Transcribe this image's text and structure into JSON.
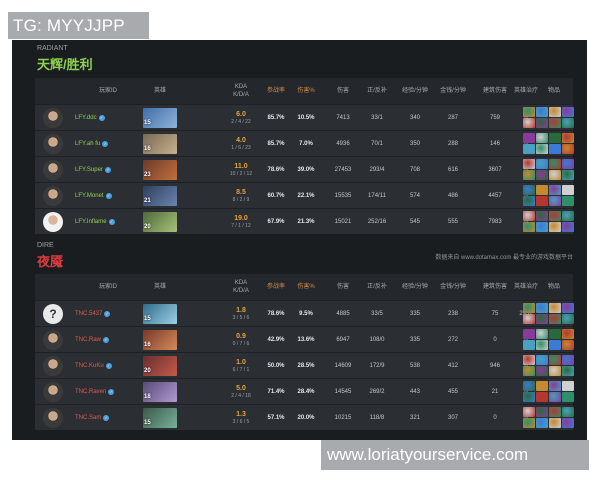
{
  "watermarks": {
    "top": "TG: MYYJJPP",
    "bottom": "www.loriatyourservice.com"
  },
  "radiant": {
    "subtitle": "RADIANT",
    "title": "天辉/胜利",
    "title_color": "#8fd14f"
  },
  "dire": {
    "subtitle": "DIRE",
    "title": "夜魇",
    "title_color": "#e23a3a",
    "source": "数据来自 www.dotamax.com 最专业的游戏数据平台"
  },
  "columns": {
    "player": "玩家ID",
    "hero": "英雄",
    "kda_line1": "KDA",
    "kda_line2": "K/D/A",
    "participation": "参战率",
    "damage_pct": "伤害%",
    "damage": "伤害",
    "lh_dn": "正/反补",
    "xpm": "经验/分钟",
    "gpm": "金钱/分钟",
    "building": "建筑伤害",
    "heal": "英雄治疗",
    "items": "物品"
  },
  "colors": {
    "name_radiant": "#8fd14f",
    "name_dire": "#e05a4a",
    "kda_ratio": "#e6a23c",
    "highlight_header": "#d48a4a"
  },
  "radiant_rows": [
    {
      "name": "LFY.ddc",
      "level": "15",
      "ratio": "6.0",
      "kda": "2 / 4 / 22",
      "part": "85.7%",
      "dmgpct": "10.5%",
      "dmg": "7413",
      "lhdn": "33/1",
      "xpm": "340",
      "gpm": "287",
      "bld": "759",
      "heal": "0",
      "avatar": "dark",
      "hero_colors": [
        "#3f6fa8",
        "#8fb3d9"
      ]
    },
    {
      "name": "LFY.ah fu",
      "level": "16",
      "ratio": "4.0",
      "kda": "1 / 6 / 23",
      "part": "85.7%",
      "dmgpct": "7.0%",
      "dmg": "4936",
      "lhdn": "70/1",
      "xpm": "350",
      "gpm": "288",
      "bld": "146",
      "heal": "0",
      "avatar": "dark",
      "hero_colors": [
        "#7a6a55",
        "#c7b08c"
      ]
    },
    {
      "name": "LFY.Super",
      "level": "23",
      "ratio": "11.0",
      "kda": "10 / 2 / 12",
      "part": "78.6%",
      "dmgpct": "39.0%",
      "dmg": "27453",
      "lhdn": "293/4",
      "xpm": "708",
      "gpm": "616",
      "bld": "3607",
      "heal": "0",
      "avatar": "dark",
      "hero_colors": [
        "#6b3a2a",
        "#c2703e"
      ]
    },
    {
      "name": "LFY.Monet",
      "level": "21",
      "ratio": "8.5",
      "kda": "8 / 2 / 9",
      "part": "60.7%",
      "dmgpct": "22.1%",
      "dmg": "15535",
      "lhdn": "174/11",
      "xpm": "574",
      "gpm": "486",
      "bld": "4457",
      "heal": "0",
      "avatar": "dark",
      "hero_colors": [
        "#2e3f5c",
        "#6a84b0"
      ]
    },
    {
      "name": "LFY.Inflame",
      "level": "20",
      "ratio": "19.0",
      "kda": "7 / 1 / 12",
      "part": "67.9%",
      "dmgpct": "21.3%",
      "dmg": "15021",
      "lhdn": "252/16",
      "xpm": "545",
      "gpm": "555",
      "bld": "7983",
      "heal": "0",
      "avatar": "light",
      "hero_colors": [
        "#4d6b3a",
        "#a8c07a"
      ]
    }
  ],
  "dire_rows": [
    {
      "name": "TNC.5437",
      "level": "15",
      "ratio": "1.8",
      "kda": "3 / 5 / 6",
      "part": "78.6%",
      "dmgpct": "9.5%",
      "dmg": "4885",
      "lhdn": "33/5",
      "xpm": "335",
      "gpm": "238",
      "bld": "75",
      "heal": "2932",
      "avatar": "question",
      "avatar_text": "?",
      "hero_colors": [
        "#2f6b8a",
        "#9fd0e6"
      ]
    },
    {
      "name": "TNC.Raw",
      "level": "16",
      "ratio": "0.9",
      "kda": "0 / 7 / 6",
      "part": "42.9%",
      "dmgpct": "13.6%",
      "dmg": "6947",
      "lhdn": "108/0",
      "xpm": "335",
      "gpm": "272",
      "bld": "0",
      "heal": "0",
      "avatar": "dark",
      "hero_colors": [
        "#7a3a2a",
        "#d48a5a"
      ]
    },
    {
      "name": "TNC.KuKu",
      "level": "20",
      "ratio": "1.0",
      "kda": "6 / 7 / 1",
      "part": "50.0%",
      "dmgpct": "28.5%",
      "dmg": "14609",
      "lhdn": "172/9",
      "xpm": "538",
      "gpm": "412",
      "bld": "946",
      "heal": "0",
      "avatar": "dark",
      "hero_colors": [
        "#6a2f2f",
        "#c45a4a"
      ]
    },
    {
      "name": "TNC.Raven",
      "level": "18",
      "ratio": "5.0",
      "kda": "2 / 4 / 18",
      "part": "71.4%",
      "dmgpct": "28.4%",
      "dmg": "14545",
      "lhdn": "269/2",
      "xpm": "443",
      "gpm": "455",
      "bld": "21",
      "heal": "0",
      "avatar": "dark",
      "hero_colors": [
        "#5a4a7a",
        "#b09ad0"
      ]
    },
    {
      "name": "TNC.Sam",
      "level": "15",
      "ratio": "1.3",
      "kda": "3 / 6 / 5",
      "part": "57.1%",
      "dmgpct": "20.0%",
      "dmg": "10215",
      "lhdn": "118/8",
      "xpm": "321",
      "gpm": "307",
      "bld": "0",
      "heal": "0",
      "avatar": "dark",
      "hero_colors": [
        "#3a5a4a",
        "#7ab09a"
      ]
    }
  ],
  "item_palette": [
    "#2f8f6a",
    "#3a7bd5",
    "#c48a2f",
    "#8a3a9a",
    "#d0d0d0",
    "#2a6a3a",
    "#b5372f",
    "#4aa0c0"
  ]
}
